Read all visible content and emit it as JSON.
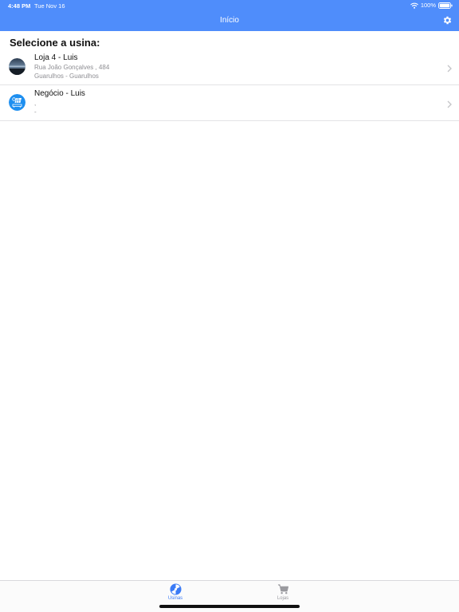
{
  "status_bar": {
    "time": "4:48 PM",
    "date": "Tue Nov 16",
    "battery": "100%"
  },
  "nav": {
    "title": "Início"
  },
  "section_title": "Selecione a usina:",
  "plants": [
    {
      "name": "Loja 4 - Luis",
      "address": "Rua João Gonçalves , 484",
      "city": "Guarulhos - Guarulhos",
      "avatar": "photo-avatar"
    },
    {
      "name": "Negócio - Luis",
      "address": ",",
      "city": "-",
      "avatar": "solar-panel-avatar"
    }
  ],
  "tabs": [
    {
      "label": "Usinas",
      "icon": "solar-tab-icon",
      "active": true
    },
    {
      "label": "Lojas",
      "icon": "cart-icon",
      "active": false
    }
  ],
  "colors": {
    "accent": "#4f8dfb",
    "tab_active": "#3b7bf6",
    "tab_inactive": "#9a9a9f"
  }
}
